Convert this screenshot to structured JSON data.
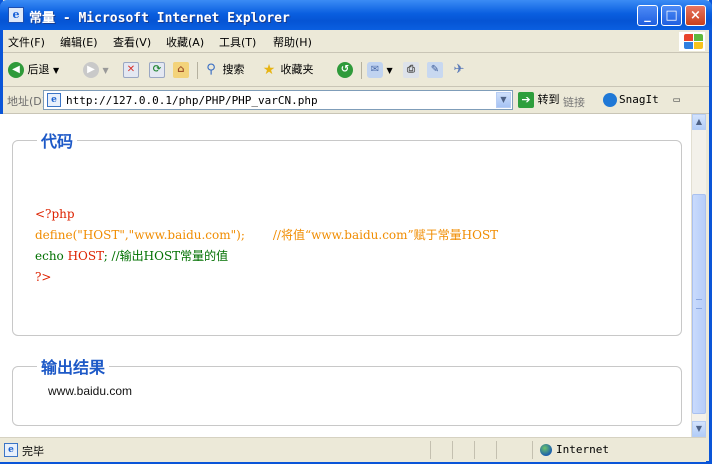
{
  "window": {
    "title": "常量 - Microsoft Internet Explorer",
    "app_icon_glyph": "e"
  },
  "menubar": {
    "items": [
      "文件(F)",
      "编辑(E)",
      "查看(V)",
      "收藏(A)",
      "工具(T)",
      "帮助(H)"
    ]
  },
  "toolbar": {
    "back_label": "后退",
    "search_label": "搜索",
    "favorites_label": "收藏夹"
  },
  "addressbar": {
    "label": "地址(D)",
    "url": "http://127.0.0.1/php/PHP/PHP_varCN.php",
    "go_label": "转到",
    "links_label": "链接",
    "snagit_label": "SnagIt"
  },
  "code_section": {
    "legend": "代码",
    "lines": [
      "<?php",
      "define(\"HOST\",\"www.baidu.com\");",
      "//将值“www.baidu.com”赋于常量HOST",
      "echo ",
      "HOST",
      "; //输出HOST常量的值",
      "?>"
    ]
  },
  "output_section": {
    "legend": "输出结果",
    "text": "www.baidu.com"
  },
  "statusbar": {
    "status": "完毕",
    "zone": "Internet"
  },
  "colors": {
    "title_blue": "#0a5fe0",
    "legend_blue": "#1d59c7",
    "code_red": "#dd2200",
    "code_orange": "#f08c00",
    "code_green": "#007000"
  }
}
